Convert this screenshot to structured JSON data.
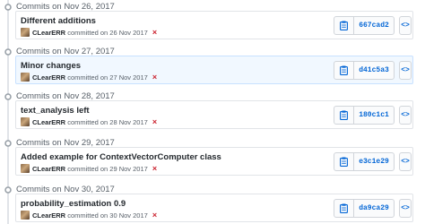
{
  "colors": {
    "link_blue": "#0366d6",
    "failure_red": "#cb2431",
    "highlight_bg": "#f1f8ff",
    "border": "#e1e4e8",
    "muted_text": "#586069"
  },
  "groups": [
    {
      "title": "Commits on Nov 26, 2017",
      "commit": {
        "message": "Different additions",
        "author": "CLearERR",
        "meta": "committed on 26 Nov 2017",
        "status_icon": "×",
        "sha": "667cad2",
        "browse_label": "<>",
        "avatar_icon": "avatar",
        "copy_icon": "clipboard-icon",
        "highlighted": false
      }
    },
    {
      "title": "Commits on Nov 27, 2017",
      "commit": {
        "message": "Minor changes",
        "author": "CLearERR",
        "meta": "committed on 27 Nov 2017",
        "status_icon": "×",
        "sha": "d41c5a3",
        "browse_label": "<>",
        "avatar_icon": "avatar",
        "copy_icon": "clipboard-icon",
        "highlighted": true
      }
    },
    {
      "title": "Commits on Nov 28, 2017",
      "commit": {
        "message": "text_analysis left",
        "author": "CLearERR",
        "meta": "committed on 28 Nov 2017",
        "status_icon": "×",
        "sha": "180c1c1",
        "browse_label": "<>",
        "avatar_icon": "avatar",
        "copy_icon": "clipboard-icon",
        "highlighted": false
      }
    },
    {
      "title": "Commits on Nov 29, 2017",
      "commit": {
        "message": "Added example for ContextVectorComputer class",
        "author": "CLearERR",
        "meta": "committed on 29 Nov 2017",
        "status_icon": "×",
        "sha": "e3c1e29",
        "browse_label": "<>",
        "avatar_icon": "avatar",
        "copy_icon": "clipboard-icon",
        "highlighted": false
      }
    },
    {
      "title": "Commits on Nov 30, 2017",
      "commit": {
        "message": "probability_estimation 0.9",
        "author": "CLearERR",
        "meta": "committed on 30 Nov 2017",
        "status_icon": "×",
        "sha": "da9ca29",
        "browse_label": "<>",
        "avatar_icon": "avatar",
        "copy_icon": "clipboard-icon",
        "highlighted": false
      }
    }
  ]
}
